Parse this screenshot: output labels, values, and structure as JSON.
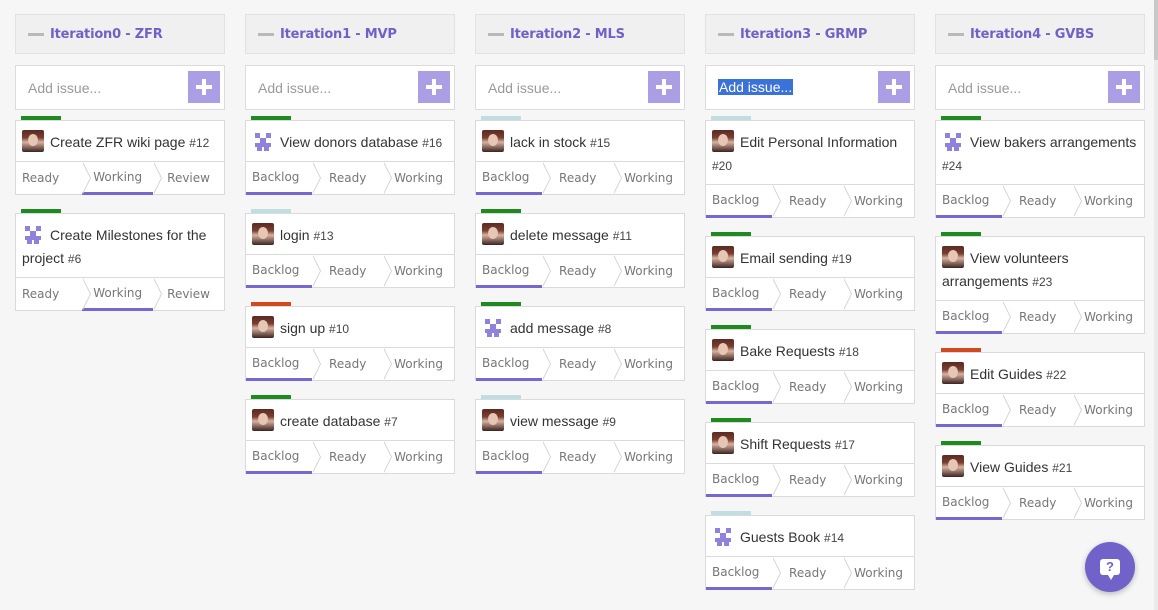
{
  "add_placeholder": "Add issue...",
  "colors": {
    "accent": "#7062c9",
    "green": "#1f8a1f",
    "light": "#c0dde0",
    "red": "#d14a1f"
  },
  "help_icon": "help-question-icon",
  "columns": [
    {
      "title": "Iteration0 - ZFR",
      "input_value": "",
      "cards": [
        {
          "title": "Create ZFR wiki page",
          "num": "#12",
          "prio": "green",
          "avatar": "photo",
          "stages": [
            "Ready",
            "Working",
            "Review"
          ],
          "active": 1
        },
        {
          "title": "Create Milestones for the project",
          "num": "#6",
          "prio": "green",
          "avatar": "ident",
          "stages": [
            "Ready",
            "Working",
            "Review"
          ],
          "active": 1
        }
      ]
    },
    {
      "title": "Iteration1 - MVP",
      "input_value": "",
      "cards": [
        {
          "title": "View donors database",
          "num": "#16",
          "prio": "green",
          "avatar": "ident",
          "stages": [
            "Backlog",
            "Ready",
            "Working"
          ],
          "active": 0
        },
        {
          "title": "login",
          "num": "#13",
          "prio": "light",
          "avatar": "photo",
          "stages": [
            "Backlog",
            "Ready",
            "Working"
          ],
          "active": 0
        },
        {
          "title": "sign up",
          "num": "#10",
          "prio": "red",
          "avatar": "photo",
          "stages": [
            "Backlog",
            "Ready",
            "Working"
          ],
          "active": 0
        },
        {
          "title": "create database",
          "num": "#7",
          "prio": "green",
          "avatar": "photo",
          "stages": [
            "Backlog",
            "Ready",
            "Working"
          ],
          "active": 0
        }
      ]
    },
    {
      "title": "Iteration2 - MLS",
      "input_value": "",
      "cards": [
        {
          "title": "lack in stock",
          "num": "#15",
          "prio": "light",
          "avatar": "photo",
          "stages": [
            "Backlog",
            "Ready",
            "Working"
          ],
          "active": 0
        },
        {
          "title": "delete message",
          "num": "#11",
          "prio": "green",
          "avatar": "photo",
          "stages": [
            "Backlog",
            "Ready",
            "Working"
          ],
          "active": 0
        },
        {
          "title": "add message",
          "num": "#8",
          "prio": "green",
          "avatar": "ident",
          "stages": [
            "Backlog",
            "Ready",
            "Working"
          ],
          "active": 0
        },
        {
          "title": "view message",
          "num": "#9",
          "prio": "light",
          "avatar": "photo",
          "stages": [
            "Backlog",
            "Ready",
            "Working"
          ],
          "active": 0
        }
      ]
    },
    {
      "title": "Iteration3 - GRMP",
      "input_value": "Add issue...",
      "cards": [
        {
          "title": "Edit Personal Information",
          "num": "#20",
          "prio": "light",
          "avatar": "photo",
          "stages": [
            "Backlog",
            "Ready",
            "Working"
          ],
          "active": 0
        },
        {
          "title": "Email sending",
          "num": "#19",
          "prio": "green",
          "avatar": "photo",
          "stages": [
            "Backlog",
            "Ready",
            "Working"
          ],
          "active": 0
        },
        {
          "title": "Bake Requests",
          "num": "#18",
          "prio": "green",
          "avatar": "photo",
          "stages": [
            "Backlog",
            "Ready",
            "Working"
          ],
          "active": 0
        },
        {
          "title": "Shift Requests",
          "num": "#17",
          "prio": "green",
          "avatar": "photo",
          "stages": [
            "Backlog",
            "Ready",
            "Working"
          ],
          "active": 0
        },
        {
          "title": "Guests Book",
          "num": "#14",
          "prio": "light",
          "avatar": "ident",
          "stages": [
            "Backlog",
            "Ready",
            "Working"
          ],
          "active": 0
        }
      ]
    },
    {
      "title": "Iteration4 - GVBS",
      "input_value": "",
      "cards": [
        {
          "title": "View bakers arrangements",
          "num": "#24",
          "prio": "green",
          "avatar": "ident",
          "stages": [
            "Backlog",
            "Ready",
            "Working"
          ],
          "active": 0
        },
        {
          "title": "View volunteers arrangements",
          "num": "#23",
          "prio": "green",
          "avatar": "photo",
          "stages": [
            "Backlog",
            "Ready",
            "Working"
          ],
          "active": 0
        },
        {
          "title": "Edit Guides",
          "num": "#22",
          "prio": "red",
          "avatar": "photo",
          "stages": [
            "Backlog",
            "Ready",
            "Working"
          ],
          "active": 0
        },
        {
          "title": "View Guides",
          "num": "#21",
          "prio": "green",
          "avatar": "photo",
          "stages": [
            "Backlog",
            "Ready",
            "Working"
          ],
          "active": 0
        }
      ]
    }
  ]
}
